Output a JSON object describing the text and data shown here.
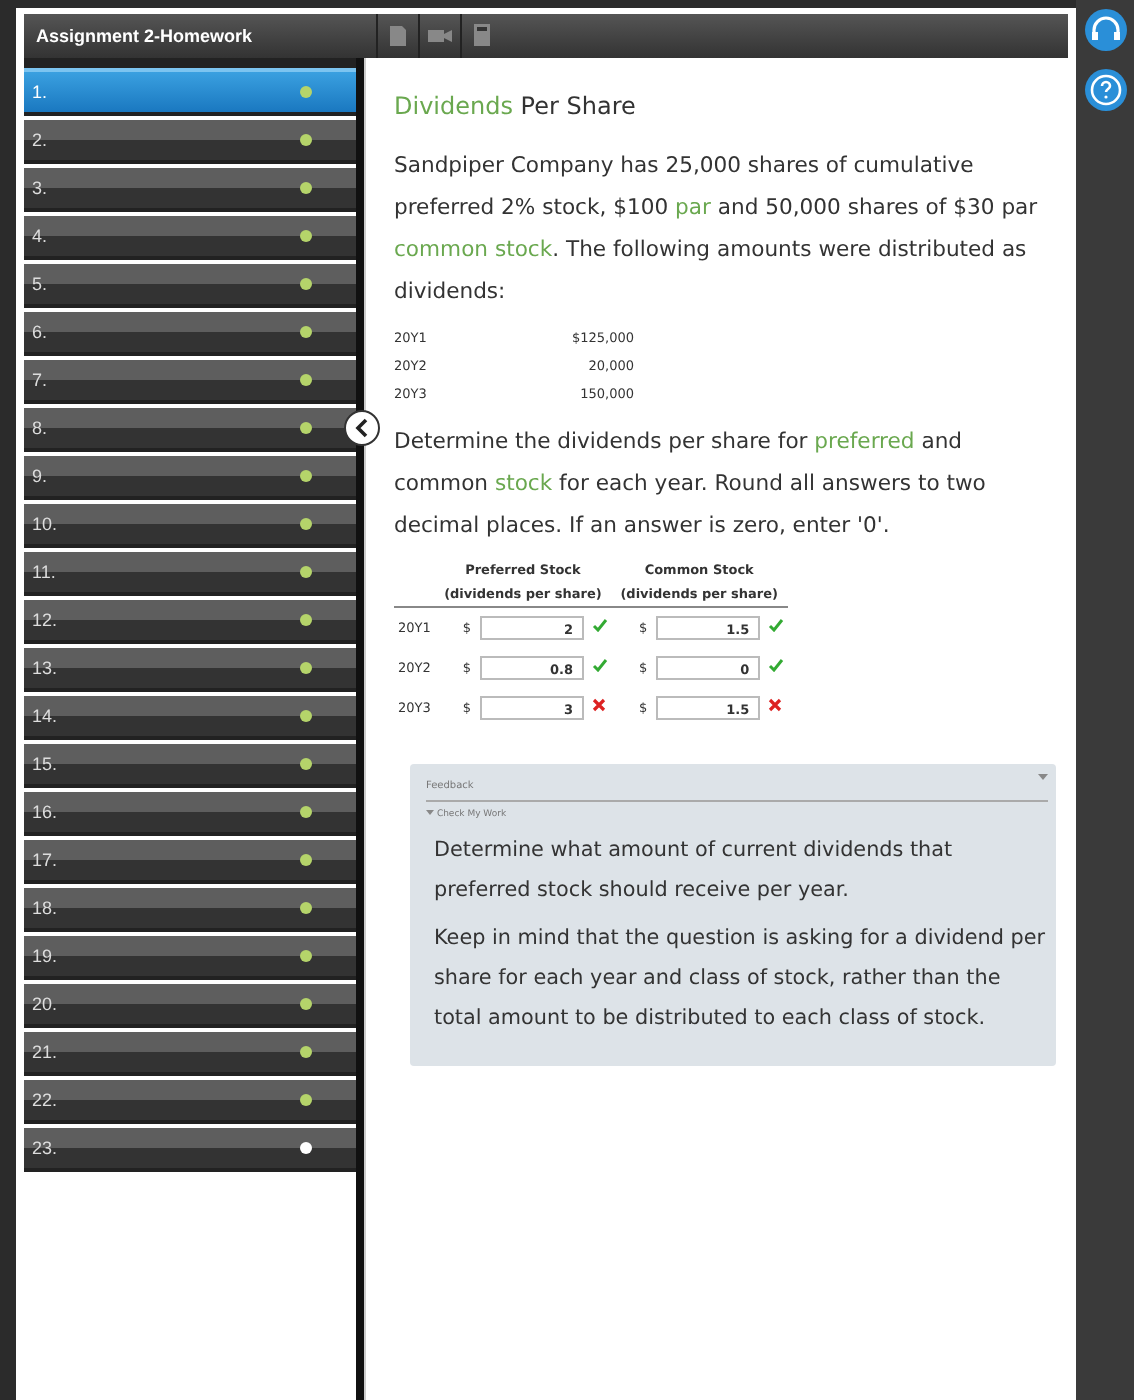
{
  "header": {
    "title": "Assignment 2-Homework"
  },
  "questions": [
    {
      "label": "1.",
      "selected": true,
      "color": "#b5d46a"
    },
    {
      "label": "2.",
      "selected": false,
      "color": "#b5d46a"
    },
    {
      "label": "3.",
      "selected": false,
      "color": "#b5d46a"
    },
    {
      "label": "4.",
      "selected": false,
      "color": "#b5d46a"
    },
    {
      "label": "5.",
      "selected": false,
      "color": "#b5d46a"
    },
    {
      "label": "6.",
      "selected": false,
      "color": "#b5d46a"
    },
    {
      "label": "7.",
      "selected": false,
      "color": "#b5d46a"
    },
    {
      "label": "8.",
      "selected": false,
      "color": "#b5d46a"
    },
    {
      "label": "9.",
      "selected": false,
      "color": "#b5d46a"
    },
    {
      "label": "10.",
      "selected": false,
      "color": "#b5d46a"
    },
    {
      "label": "11.",
      "selected": false,
      "color": "#b5d46a"
    },
    {
      "label": "12.",
      "selected": false,
      "color": "#b5d46a"
    },
    {
      "label": "13.",
      "selected": false,
      "color": "#b5d46a"
    },
    {
      "label": "14.",
      "selected": false,
      "color": "#b5d46a"
    },
    {
      "label": "15.",
      "selected": false,
      "color": "#b5d46a"
    },
    {
      "label": "16.",
      "selected": false,
      "color": "#b5d46a"
    },
    {
      "label": "17.",
      "selected": false,
      "color": "#b5d46a"
    },
    {
      "label": "18.",
      "selected": false,
      "color": "#b5d46a"
    },
    {
      "label": "19.",
      "selected": false,
      "color": "#b5d46a"
    },
    {
      "label": "20.",
      "selected": false,
      "color": "#b5d46a"
    },
    {
      "label": "21.",
      "selected": false,
      "color": "#b5d46a"
    },
    {
      "label": "22.",
      "selected": false,
      "color": "#b5d46a"
    },
    {
      "label": "23.",
      "selected": false,
      "color": "#ffffff"
    }
  ],
  "title": [
    {
      "text": "Dividends",
      "link": true
    },
    {
      "text": " Per Share",
      "link": false
    }
  ],
  "intro": [
    {
      "text": "Sandpiper Company has 25,000 shares of cumulative preferred 2% stock, $100 ",
      "link": false
    },
    {
      "text": "par",
      "link": true
    },
    {
      "text": " and 50,000 shares of $30 par ",
      "link": false
    },
    {
      "text": "common stock",
      "link": true
    },
    {
      "text": ". The following amounts were distributed as dividends:",
      "link": false
    }
  ],
  "distributions": [
    {
      "year": "20Y1",
      "amount": "$125,000"
    },
    {
      "year": "20Y2",
      "amount": "20,000"
    },
    {
      "year": "20Y3",
      "amount": "150,000"
    }
  ],
  "instructions": [
    {
      "text": "Determine the dividends per share for ",
      "link": false
    },
    {
      "text": "preferred",
      "link": true
    },
    {
      "text": " and common ",
      "link": false
    },
    {
      "text": "stock",
      "link": true
    },
    {
      "text": " for each year. Round all answers to two decimal places. If an answer is zero, enter '0'.",
      "link": false
    }
  ],
  "answer_table": {
    "columns": [
      {
        "title": "Preferred Stock",
        "subtitle": "(dividends per share)"
      },
      {
        "title": "Common Stock",
        "subtitle": "(dividends per share)"
      }
    ],
    "rows": [
      {
        "year": "20Y1",
        "cells": [
          {
            "currency": "$",
            "value": "2",
            "correct": true
          },
          {
            "currency": "$",
            "value": "1.5",
            "correct": true
          }
        ]
      },
      {
        "year": "20Y2",
        "cells": [
          {
            "currency": "$",
            "value": "0.8",
            "correct": true
          },
          {
            "currency": "$",
            "value": "0",
            "correct": true
          }
        ]
      },
      {
        "year": "20Y3",
        "cells": [
          {
            "currency": "$",
            "value": "3",
            "correct": false
          },
          {
            "currency": "$",
            "value": "1.5",
            "correct": false
          }
        ]
      }
    ]
  },
  "feedback": {
    "title": "Feedback",
    "expanded": true,
    "section": "Check My Work",
    "paragraphs": [
      "Determine what amount of current dividends that preferred stock should receive per year.",
      "Keep in mind that the question is asking for a dividend per share for each year and class of stock, rather than the total amount to be distributed to each class of stock."
    ]
  }
}
